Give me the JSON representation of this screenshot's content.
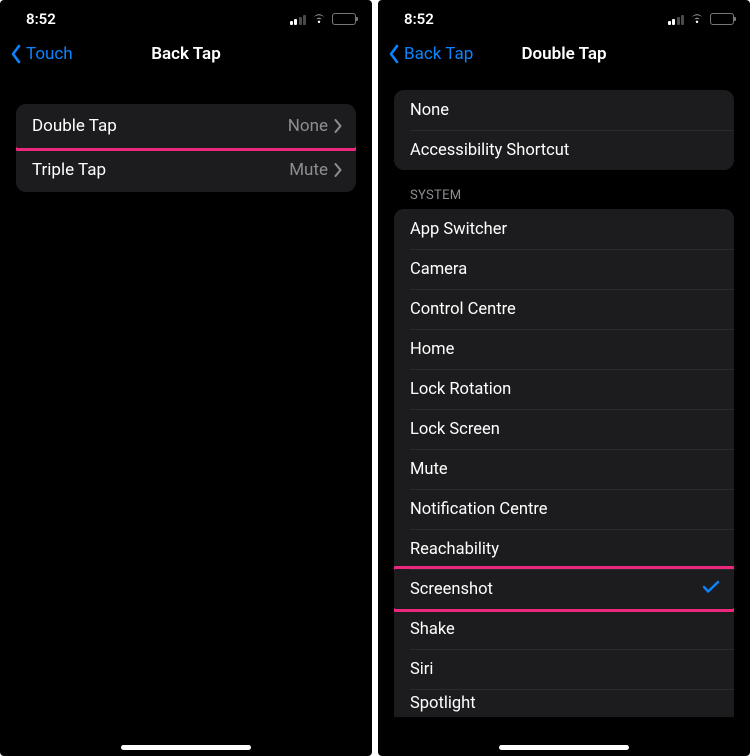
{
  "status": {
    "time": "8:52"
  },
  "left": {
    "back": "Touch",
    "title": "Back Tap",
    "rows": [
      {
        "label": "Double Tap",
        "value": "None",
        "highlight": true
      },
      {
        "label": "Triple Tap",
        "value": "Mute",
        "highlight": false
      }
    ]
  },
  "right": {
    "back": "Back Tap",
    "title": "Double Tap",
    "group1": [
      {
        "label": "None"
      },
      {
        "label": "Accessibility Shortcut"
      }
    ],
    "section_header": "SYSTEM",
    "system": [
      {
        "label": "App Switcher"
      },
      {
        "label": "Camera"
      },
      {
        "label": "Control Centre"
      },
      {
        "label": "Home"
      },
      {
        "label": "Lock Rotation"
      },
      {
        "label": "Lock Screen"
      },
      {
        "label": "Mute"
      },
      {
        "label": "Notification Centre"
      },
      {
        "label": "Reachability"
      },
      {
        "label": "Screenshot",
        "selected": true,
        "highlight": true
      },
      {
        "label": "Shake"
      },
      {
        "label": "Siri"
      },
      {
        "label": "Spotlight"
      }
    ]
  }
}
